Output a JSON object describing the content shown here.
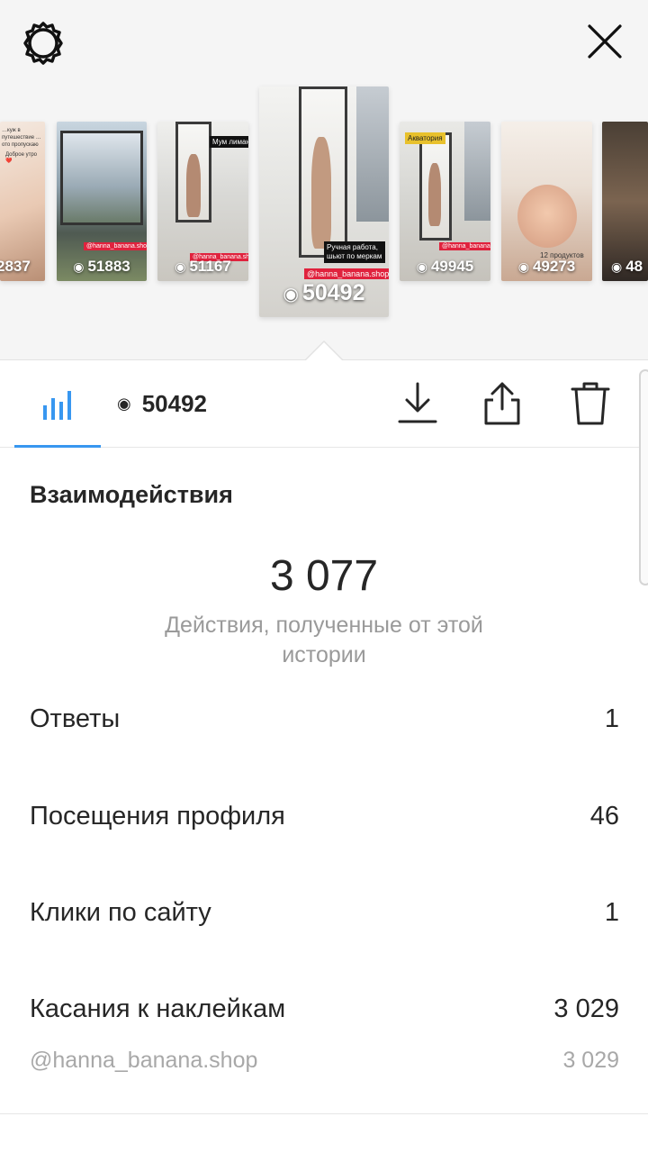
{
  "header": {
    "settings_icon": "gear-icon",
    "close_icon": "close-icon"
  },
  "stories": [
    {
      "count": "2837",
      "caption_top": "…куж в путешествие …ото пропускаю",
      "caption_mid": "Доброе утро ❤️"
    },
    {
      "count": "51883",
      "tag": "@hanna_banana.shop"
    },
    {
      "count": "51167",
      "note": "Мум лиман",
      "tag": "@hanna_banana.shop"
    },
    {
      "count": "50492",
      "note": "Ручная работа, шьют по меркам",
      "tag": "@hanna_banana.shop"
    },
    {
      "count": "49945",
      "note": "Акватория",
      "tag": "@hanna_banana.shop"
    },
    {
      "count": "49273",
      "note": "12 продуктов"
    },
    {
      "count": "48"
    }
  ],
  "toolbar": {
    "views": "50492",
    "insights_icon": "bar-chart-icon",
    "download_icon": "download-icon",
    "share_icon": "share-icon",
    "delete_icon": "trash-icon",
    "accent": "#3897f0"
  },
  "interactions": {
    "title": "Взаимодействия",
    "total": "3 077",
    "caption": "Действия, полученные от этой истории",
    "rows": [
      {
        "label": "Ответы",
        "value": "1"
      },
      {
        "label": "Посещения профиля",
        "value": "46"
      },
      {
        "label": "Клики по сайту",
        "value": "1"
      },
      {
        "label": "Касания к наклейкам",
        "value": "3 029"
      }
    ],
    "sticker": {
      "label": "@hanna_banana.shop",
      "value": "3 029"
    }
  }
}
